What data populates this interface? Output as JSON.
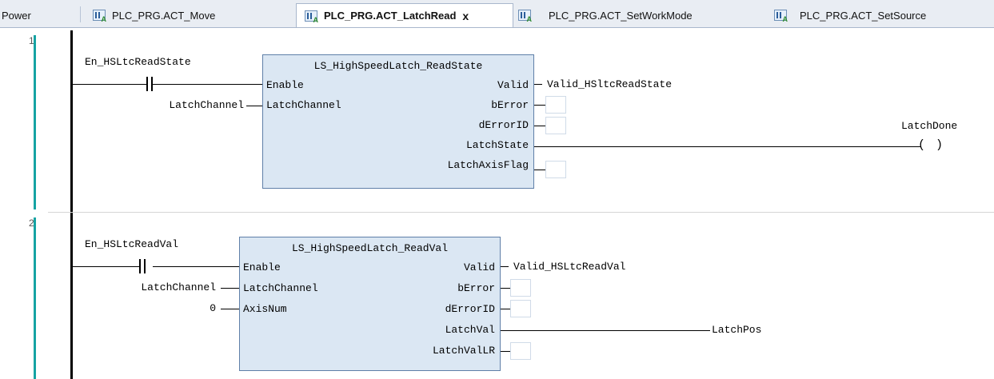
{
  "tabs": [
    {
      "label": "Power"
    },
    {
      "label": "PLC_PRG.ACT_Move"
    },
    {
      "label": "PLC_PRG.ACT_LatchRead",
      "active": true,
      "close": "x"
    },
    {
      "label": "PLC_PRG.ACT_SetWorkMode"
    },
    {
      "label": "PLC_PRG.ACT_SetSource"
    }
  ],
  "networks": [
    {
      "number": "1",
      "contact_var": "En_HSLtcReadState",
      "block_title": "LS_HighSpeedLatch_ReadState",
      "inputs": [
        {
          "pin": "Enable",
          "var": ""
        },
        {
          "pin": "LatchChannel",
          "var": "LatchChannel"
        }
      ],
      "outputs": [
        {
          "pin": "Valid",
          "var": "Valid_HSltcReadState"
        },
        {
          "pin": "bError",
          "var": ""
        },
        {
          "pin": "dErrorID",
          "var": ""
        },
        {
          "pin": "LatchState",
          "var": ""
        },
        {
          "pin": "LatchAxisFlag",
          "var": ""
        }
      ],
      "coil_var": "LatchDone"
    },
    {
      "number": "2",
      "contact_var": "En_HSLtcReadVal",
      "block_title": "LS_HighSpeedLatch_ReadVal",
      "inputs": [
        {
          "pin": "Enable",
          "var": ""
        },
        {
          "pin": "LatchChannel",
          "var": "LatchChannel"
        },
        {
          "pin": "AxisNum",
          "var": "0"
        }
      ],
      "outputs": [
        {
          "pin": "Valid",
          "var": "Valid_HSLtcReadVal"
        },
        {
          "pin": "bError",
          "var": ""
        },
        {
          "pin": "dErrorID",
          "var": ""
        },
        {
          "pin": "LatchVal",
          "var": "LatchPos"
        },
        {
          "pin": "LatchValLR",
          "var": ""
        }
      ]
    }
  ]
}
